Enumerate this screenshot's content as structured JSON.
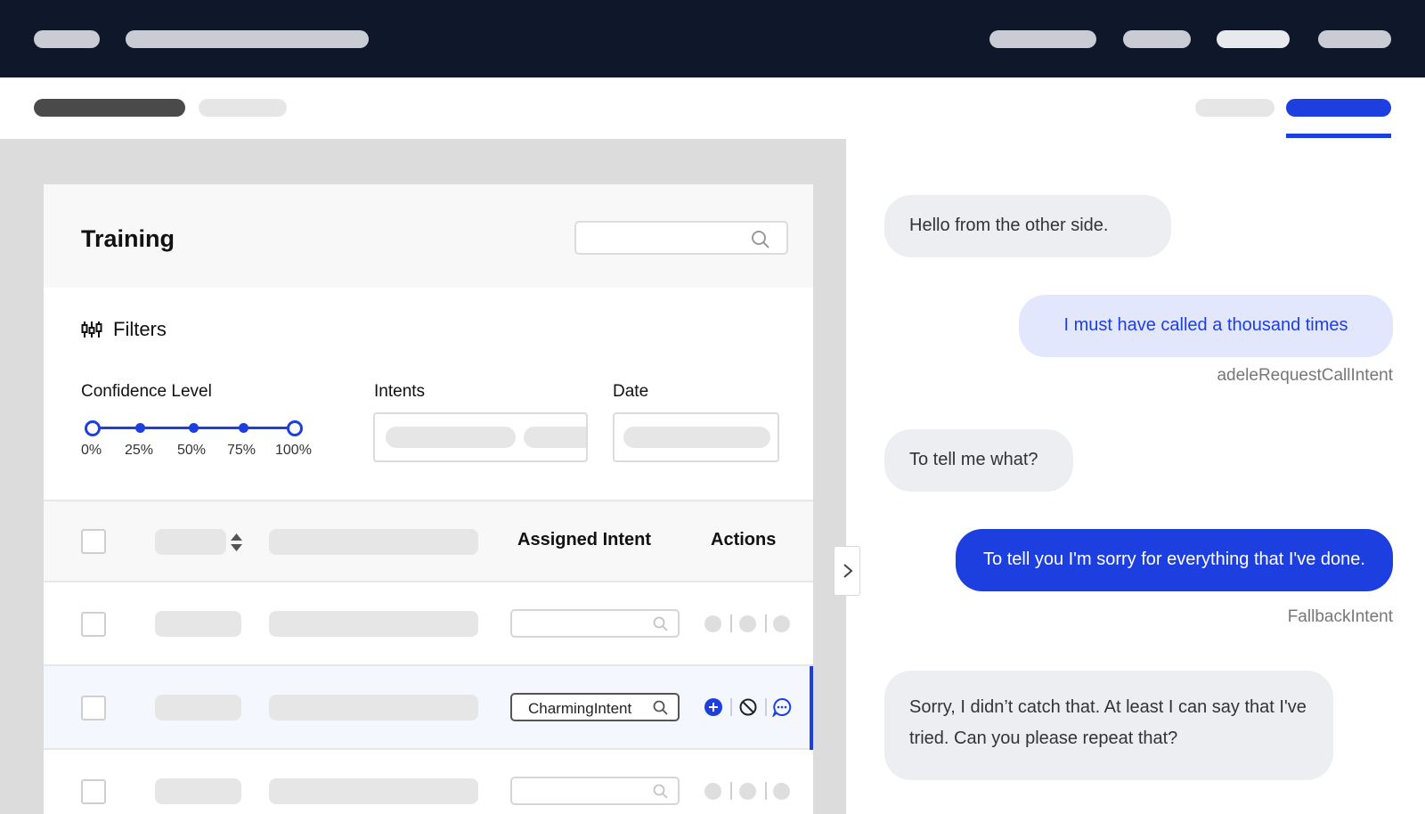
{
  "colors": {
    "accent": "#1d3fe0",
    "topbar": "#0f172b",
    "bubble_gray": "#eceef1",
    "bubble_light": "#e2e7fd"
  },
  "training": {
    "title": "Training",
    "filters_label": "Filters",
    "confidence_label": "Confidence Level",
    "confidence_ticks": [
      "0%",
      "25%",
      "50%",
      "75%",
      "100%"
    ],
    "confidence_range": [
      0,
      100
    ],
    "intents_label": "Intents",
    "date_label": "Date"
  },
  "table": {
    "headers": {
      "assigned_intent": "Assigned Intent",
      "actions": "Actions"
    },
    "rows": [
      {
        "assigned_intent": "",
        "active": false
      },
      {
        "assigned_intent": "CharmingIntent",
        "active": true
      },
      {
        "assigned_intent": "",
        "active": false
      }
    ]
  },
  "chat": {
    "messages": [
      {
        "from": "bot",
        "text": "Hello from the other side."
      },
      {
        "from": "user",
        "text": "I must have called a thousand times",
        "intent": "adeleRequestCallIntent"
      },
      {
        "from": "bot",
        "text": "To tell me what?"
      },
      {
        "from": "user",
        "text": "To tell you I'm sorry for everything that I've done.",
        "intent": "FallbackIntent"
      },
      {
        "from": "bot",
        "text": "Sorry, I didn’t catch that. At least I can say that I've tried. Can you please repeat that?"
      }
    ]
  }
}
